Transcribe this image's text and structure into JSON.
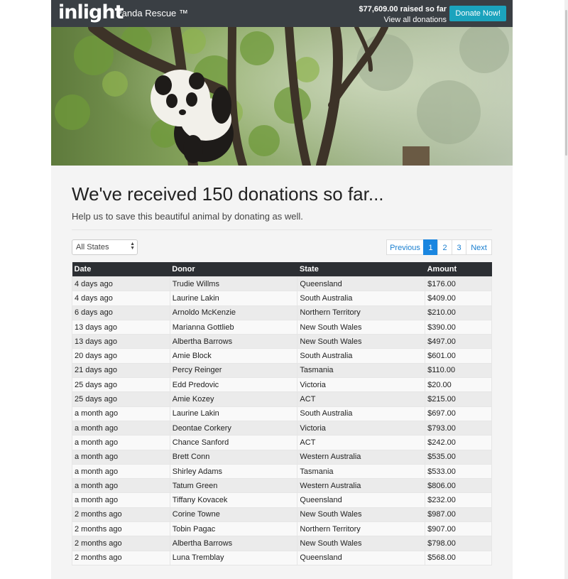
{
  "header": {
    "logo_text": "inlight",
    "org_name": "Panda Rescue ™",
    "raised_text": "$77,609.00 raised so far",
    "view_all_label": "View all donations",
    "donate_label": "Donate Now!"
  },
  "main": {
    "heading": "We've received 150 donations so far...",
    "subheading": "Help us to save this beautiful animal by donating as well.",
    "state_filter": {
      "selected": "All States"
    },
    "pagination": {
      "previous": "Previous",
      "pages": [
        "1",
        "2",
        "3"
      ],
      "active": "1",
      "next": "Next"
    },
    "table": {
      "columns": [
        "Date",
        "Donor",
        "State",
        "Amount"
      ],
      "rows": [
        [
          "4 days ago",
          "Trudie Willms",
          "Queensland",
          "$176.00"
        ],
        [
          "4 days ago",
          "Laurine Lakin",
          "South Australia",
          "$409.00"
        ],
        [
          "6 days ago",
          "Arnoldo McKenzie",
          "Northern Territory",
          "$210.00"
        ],
        [
          "13 days ago",
          "Marianna Gottlieb",
          "New South Wales",
          "$390.00"
        ],
        [
          "13 days ago",
          "Albertha Barrows",
          "New South Wales",
          "$497.00"
        ],
        [
          "20 days ago",
          "Amie Block",
          "South Australia",
          "$601.00"
        ],
        [
          "21 days ago",
          "Percy Reinger",
          "Tasmania",
          "$110.00"
        ],
        [
          "25 days ago",
          "Edd Predovic",
          "Victoria",
          "$20.00"
        ],
        [
          "25 days ago",
          "Amie Kozey",
          "ACT",
          "$215.00"
        ],
        [
          "a month ago",
          "Laurine Lakin",
          "South Australia",
          "$697.00"
        ],
        [
          "a month ago",
          "Deontae Corkery",
          "Victoria",
          "$793.00"
        ],
        [
          "a month ago",
          "Chance Sanford",
          "ACT",
          "$242.00"
        ],
        [
          "a month ago",
          "Brett Conn",
          "Western Australia",
          "$535.00"
        ],
        [
          "a month ago",
          "Shirley Adams",
          "Tasmania",
          "$533.00"
        ],
        [
          "a month ago",
          "Tatum Green",
          "Western Australia",
          "$806.00"
        ],
        [
          "a month ago",
          "Tiffany Kovacek",
          "Queensland",
          "$232.00"
        ],
        [
          "2 months ago",
          "Corine Towne",
          "New South Wales",
          "$987.00"
        ],
        [
          "2 months ago",
          "Tobin Pagac",
          "Northern Territory",
          "$907.00"
        ],
        [
          "2 months ago",
          "Albertha Barrows",
          "New South Wales",
          "$798.00"
        ],
        [
          "2 months ago",
          "Luna Tremblay",
          "Queensland",
          "$568.00"
        ]
      ]
    }
  },
  "colors": {
    "topbar": "#3a3f44",
    "donate_button": "#1ba3bd",
    "link": "#1a7fd0",
    "active_page": "#1a86e0",
    "table_header": "#2c2f33"
  },
  "icons": [
    "dropdown-caret-icon"
  ],
  "hero_image": "panda-in-tree-photo"
}
